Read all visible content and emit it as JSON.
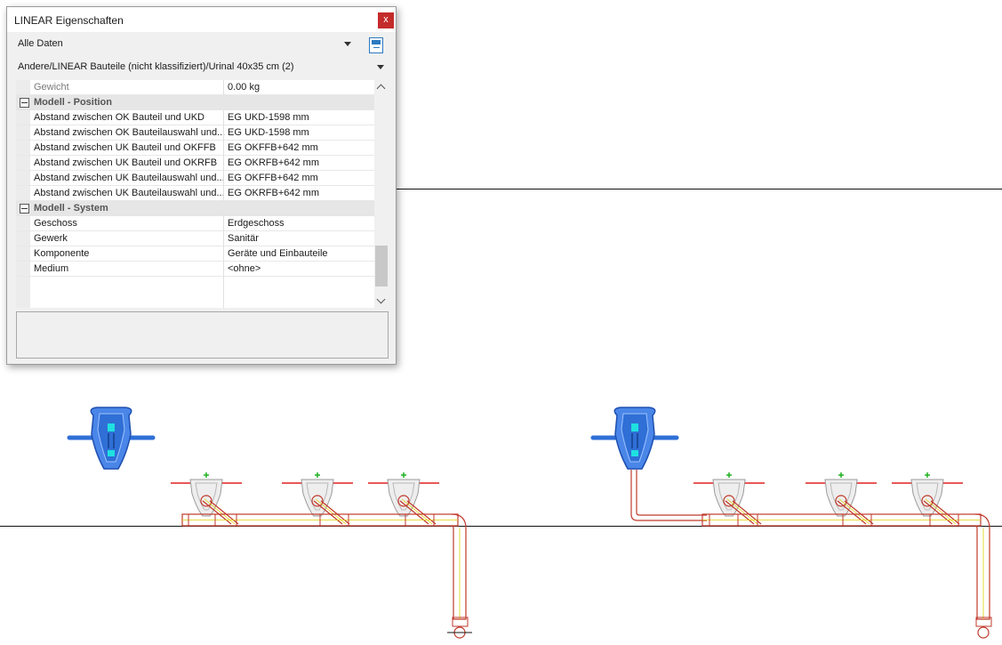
{
  "panel": {
    "title": "LINEAR Eigenschaften",
    "close_label": "x",
    "filter_value": "Alle Daten",
    "element_path": "Andere/LINEAR Bauteile (nicht klassifiziert)/Urinal 40x35 cm (2)"
  },
  "properties": {
    "top_row": {
      "name": "Gewicht",
      "value": "0.00 kg"
    },
    "position": {
      "category": "Modell - Position",
      "rows": [
        {
          "name": "Abstand zwischen OK Bauteil und UKD",
          "value": "EG UKD-1598 mm"
        },
        {
          "name": "Abstand zwischen OK Bauteilauswahl und...",
          "value": "EG UKD-1598 mm"
        },
        {
          "name": "Abstand zwischen UK Bauteil und OKFFB",
          "value": "EG OKFFB+642 mm"
        },
        {
          "name": "Abstand zwischen UK Bauteil und OKRFB",
          "value": "EG OKRFB+642 mm"
        },
        {
          "name": "Abstand zwischen UK Bauteilauswahl und...",
          "value": "EG OKFFB+642 mm"
        },
        {
          "name": "Abstand zwischen UK Bauteilauswahl und...",
          "value": "EG OKRFB+642 mm"
        }
      ]
    },
    "system": {
      "category": "Modell - System",
      "rows": [
        {
          "name": "Geschoss",
          "value": "Erdgeschoss"
        },
        {
          "name": "Gewerk",
          "value": "Sanitär"
        },
        {
          "name": "Komponente",
          "value": "Geräte und Einbauteile"
        },
        {
          "name": "Medium",
          "value": "<ohne>"
        }
      ]
    }
  },
  "icons": {
    "dropdown": "chevron-down-icon",
    "side_button": "dock-panel-icon",
    "collapse": "collapse-minus-icon",
    "cad_symbol": "urinal-symbol-icon",
    "cad_marker": "plus-marker-icon"
  },
  "colors": {
    "close_button": "#c42b2b",
    "selection_blue": "#2f6fd6",
    "pipe_red": "#c0392b",
    "pipe_yellow": "#e0d000",
    "fixture_gray": "#a0a0a0",
    "marker_green": "#20b020"
  }
}
